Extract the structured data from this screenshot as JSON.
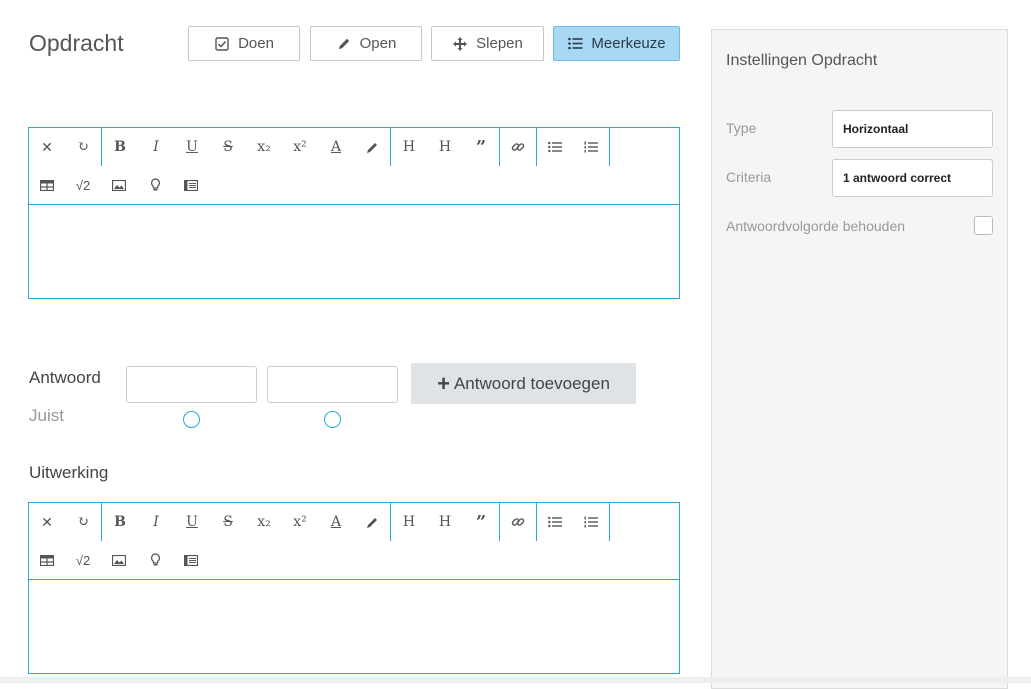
{
  "header": {
    "title": "Opdracht"
  },
  "type_buttons": [
    {
      "label": "Doen",
      "icon": "checkbox-icon",
      "active": false
    },
    {
      "label": "Open",
      "icon": "pencil-icon",
      "active": false
    },
    {
      "label": "Slepen",
      "icon": "move-icon",
      "active": false
    },
    {
      "label": "Meerkeuze",
      "icon": "list-icon",
      "active": true
    }
  ],
  "toolbar_icons": {
    "row1": [
      [
        "clear-format-icon",
        "redo-icon"
      ],
      [
        "bold-icon",
        "italic-icon",
        "underline-icon",
        "strikethrough-icon",
        "subscript-icon",
        "superscript-icon",
        "font-color-icon",
        "highlight-icon"
      ],
      [
        "heading-1-icon",
        "heading-2-icon",
        "quote-icon"
      ],
      [
        "link-icon"
      ],
      [
        "bullet-list-icon",
        "numbered-list-icon"
      ]
    ],
    "row2": [
      "table-icon",
      "sqrt-icon",
      "image-icon",
      "lightbulb-icon",
      "card-icon"
    ]
  },
  "answers": {
    "label": "Antwoord",
    "correct_label": "Juist",
    "add_button": "Antwoord toevoegen",
    "inputs": [
      "",
      ""
    ]
  },
  "uitwerking": {
    "label": "Uitwerking"
  },
  "settings": {
    "title": "Instellingen Opdracht",
    "type_label": "Type",
    "type_value": "Horizontaal",
    "criteria_label": "Criteria",
    "criteria_value": "1 antwoord correct",
    "order_label": "Antwoordvolgorde behouden",
    "order_checked": false
  },
  "colors": {
    "accent": "#2aa8d6",
    "active_button": "#a8d8f4",
    "panel_bg": "#f5f5f5"
  }
}
